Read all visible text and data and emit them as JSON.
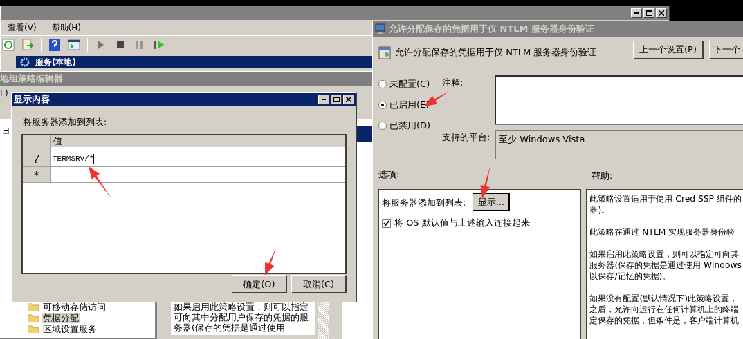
{
  "services_window": {
    "menu": [
      "查看(V)",
      "帮助(H)"
    ],
    "header": "服务(本地)"
  },
  "gpe_window": {
    "title": "地组策略编辑器",
    "menu_fragment": "F)",
    "tree": [
      {
        "label": "可移动存储访问",
        "selected": false
      },
      {
        "label": "凭据分配",
        "selected": true
      },
      {
        "label": "区域设置服务",
        "selected": false
      }
    ],
    "description_lines": [
      "如果启用此策略设置，则可以指定",
      "可向其中分配用户保存的凭据的服",
      "务器(保存的凭据是通过使用"
    ]
  },
  "policy_dialog": {
    "title": "允许分配保存的凭据用于仅 NTLM 服务器身份验证",
    "heading": "允许分配保存的凭据用于仅 NTLM 服务器身份验证",
    "prev_button": "上一个设置(P)",
    "next_button": "下一个",
    "states": [
      {
        "label": "未配置(C)",
        "selected": false
      },
      {
        "label": "已启用(E)",
        "selected": true
      },
      {
        "label": "已禁用(D)",
        "selected": false
      }
    ],
    "comment_label": "注释:",
    "platform_label": "支持的平台:",
    "platform": "至少 Windows Vista",
    "options_label": "选项:",
    "help_label": "帮助:",
    "options": {
      "servers_label": "将服务器添加到列表:",
      "show_button": "显示...",
      "concat": {
        "label": "将 OS 默认值与上述输入连接起来",
        "checked": true
      }
    },
    "help_paragraphs": [
      [
        "此策略设置适用于使用 Cred SSP 组件的",
        "器)。"
      ],
      [
        "此策略在通过 NTLM 实现服务器身份验"
      ],
      [
        "如果启用此策略设置，则可以指定可向其",
        "服务器(保存的凭据是通过使用 Windows",
        "以保存/记忆的凭据)。"
      ],
      [
        "如果没有配置(默认情况下)此策略设置，",
        "之后，允许向运行在任何计算机上的终端",
        "定保存的凭据，但条件是，客户端计算机"
      ]
    ]
  },
  "show_dialog": {
    "title": "显示内容",
    "label": "将服务器添加到列表:",
    "column": "值",
    "rows": [
      {
        "value": "TERMSRV/*",
        "kind": "edit"
      },
      {
        "marker": "*",
        "kind": "new"
      }
    ],
    "ok_button": "确定(O)",
    "cancel_button": "取消(C)"
  }
}
